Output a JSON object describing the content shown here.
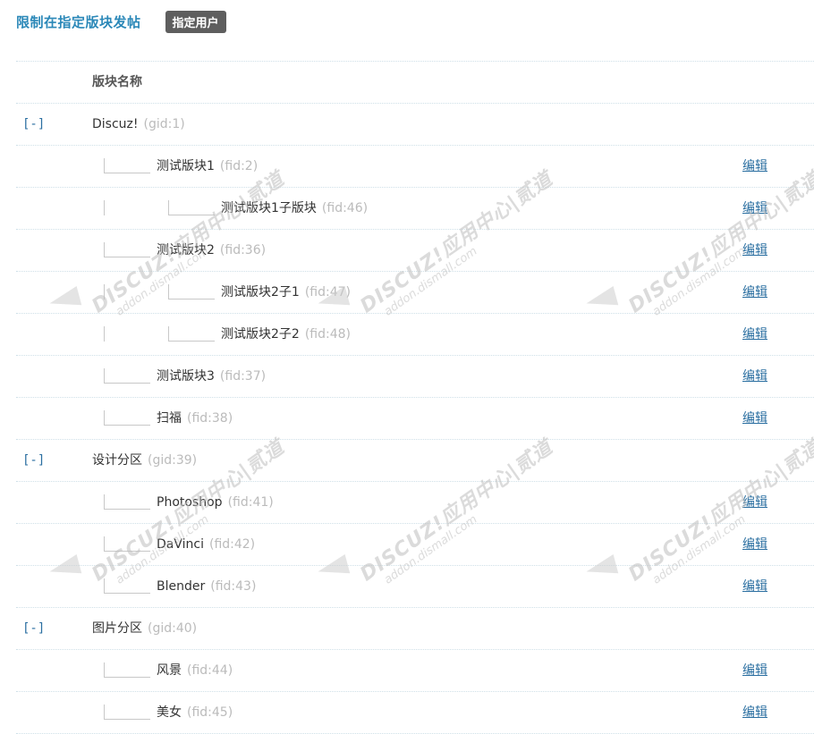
{
  "header": {
    "title": "限制在指定版块发帖",
    "assign_button": "指定用户"
  },
  "table": {
    "column_header": "版块名称",
    "edit_label": "编辑",
    "rows": [
      {
        "type": "group",
        "toggle": "[-]",
        "name": "Discuz!",
        "id": "(gid:1)"
      },
      {
        "type": "lvl1",
        "name": "测试版块1",
        "id": "(fid:2)"
      },
      {
        "type": "lvl2",
        "name": "测试版块1子版块",
        "id": "(fid:46)"
      },
      {
        "type": "lvl1",
        "name": "测试版块2",
        "id": "(fid:36)"
      },
      {
        "type": "lvl2",
        "name": "测试版块2子1",
        "id": "(fid:47)"
      },
      {
        "type": "lvl2",
        "name": "测试版块2子2",
        "id": "(fid:48)"
      },
      {
        "type": "lvl1",
        "name": "测试版块3",
        "id": "(fid:37)"
      },
      {
        "type": "lvl1",
        "name": "扫福",
        "id": "(fid:38)"
      },
      {
        "type": "group",
        "toggle": "[-]",
        "name": "设计分区",
        "id": "(gid:39)"
      },
      {
        "type": "lvl1",
        "name": "Photoshop",
        "id": "(fid:41)"
      },
      {
        "type": "lvl1",
        "name": "DaVinci",
        "id": "(fid:42)"
      },
      {
        "type": "lvl1",
        "name": "Blender",
        "id": "(fid:43)"
      },
      {
        "type": "group",
        "toggle": "[-]",
        "name": "图片分区",
        "id": "(gid:40)"
      },
      {
        "type": "lvl1",
        "name": "风景",
        "id": "(fid:44)"
      },
      {
        "type": "lvl1",
        "name": "美女",
        "id": "(fid:45)"
      }
    ]
  },
  "watermark": {
    "line1": "DISCUZ!应用中心|贰道",
    "line2": "addon.dismall.com"
  },
  "colors": {
    "title": "#2b88b8",
    "button_bg": "#5e5e5e",
    "link": "#2b6fa1",
    "id_text": "#bbbbbb"
  }
}
